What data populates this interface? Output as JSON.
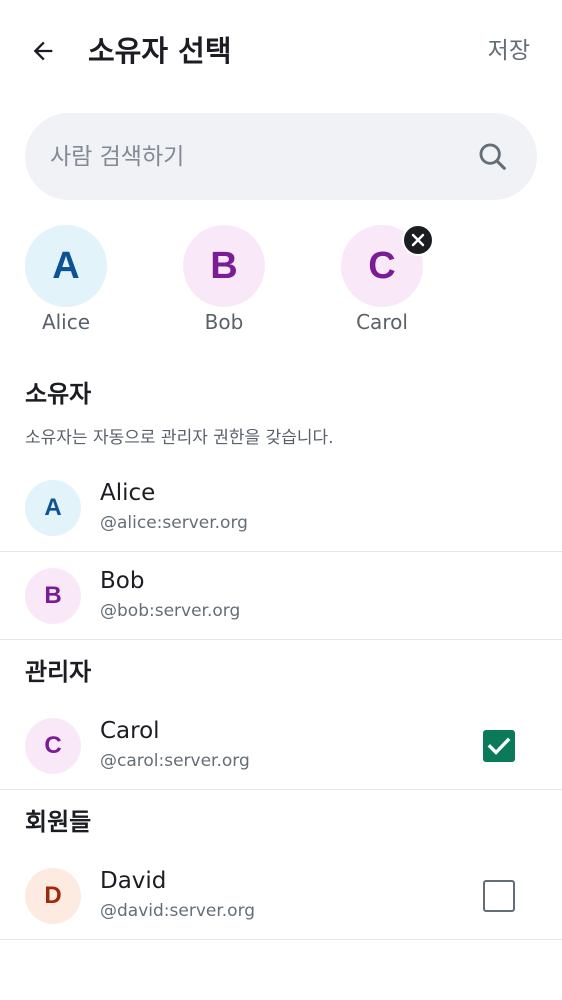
{
  "header": {
    "title": "소유자 선택",
    "save_label": "저장"
  },
  "search": {
    "placeholder": "사람 검색하기",
    "value": ""
  },
  "selected_chips": [
    {
      "initial": "A",
      "name": "Alice",
      "bg": "#e3f3fa",
      "fg": "#0b5394",
      "removable": false
    },
    {
      "initial": "B",
      "name": "Bob",
      "bg": "#f9e9f8",
      "fg": "#7a1c96",
      "removable": false
    },
    {
      "initial": "C",
      "name": "Carol",
      "bg": "#f9e9f8",
      "fg": "#7a1c96",
      "removable": true
    }
  ],
  "owners_section": {
    "header": "소유자",
    "description": "소유자는 자동으로 관리자 권한을 갖습니다.",
    "members": [
      {
        "initial": "A",
        "name": "Alice",
        "id": "@alice:server.org",
        "bg": "#e3f3fa",
        "fg": "#0b5394"
      },
      {
        "initial": "B",
        "name": "Bob",
        "id": "@bob:server.org",
        "bg": "#f9e9f8",
        "fg": "#7a1c96"
      }
    ]
  },
  "admins_section": {
    "header": "관리자",
    "members": [
      {
        "initial": "C",
        "name": "Carol",
        "id": "@carol:server.org",
        "bg": "#f9e9f8",
        "fg": "#7a1c96",
        "checked": true
      }
    ]
  },
  "members_section": {
    "header": "회원들",
    "members": [
      {
        "initial": "D",
        "name": "David",
        "id": "@david:server.org",
        "bg": "#fdebe1",
        "fg": "#a0280c",
        "checked": false
      }
    ]
  },
  "colors": {
    "accent": "#0b7a5a",
    "text_primary": "#1b1d22",
    "text_secondary": "#656d77",
    "search_bg": "#f0f2f5"
  }
}
